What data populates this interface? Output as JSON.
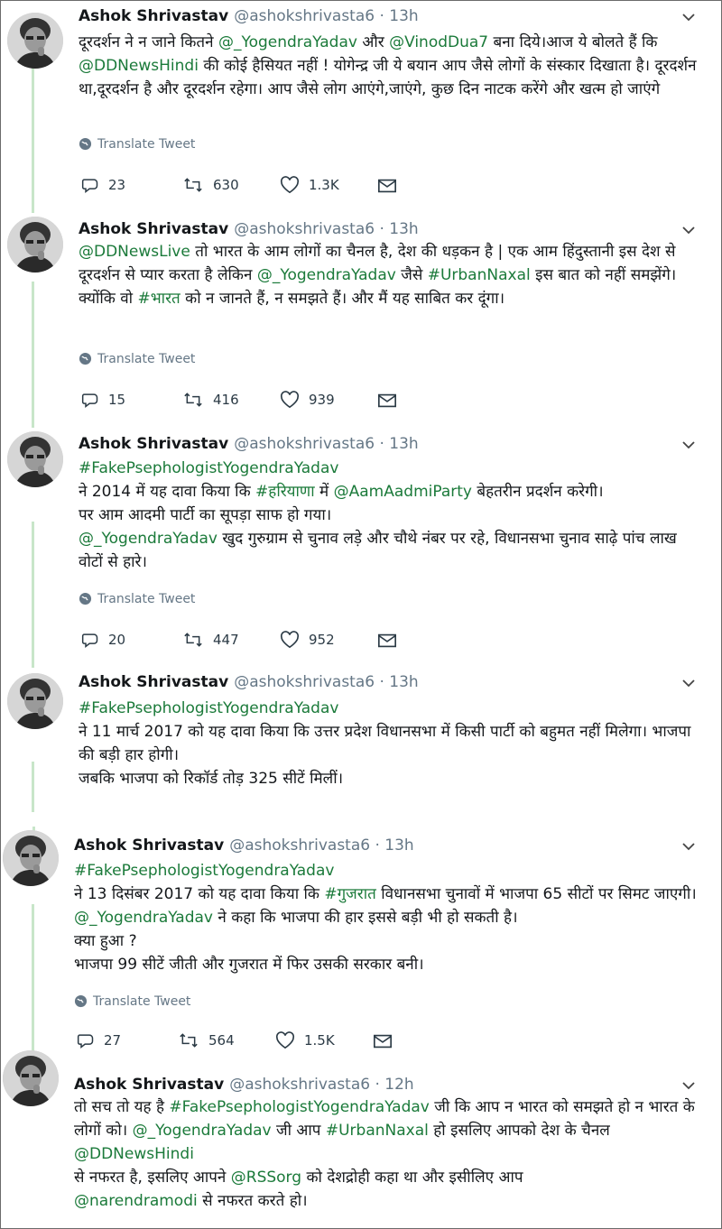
{
  "tweets": [
    {
      "name": "Ashok Shrivastav",
      "handle": "@ashokshrivasta6 · 13h",
      "body": [
        {
          "t": "दूरदर्शन ने न जाने कितने "
        },
        {
          "t": "@_YogendraYadav",
          "link": true
        },
        {
          "t": " और "
        },
        {
          "t": "@VinodDua7",
          "link": true
        },
        {
          "t": " बना दिये।आज ये बोलते हैं कि "
        },
        {
          "t": "@DDNewsHindi",
          "link": true
        },
        {
          "t": " की कोई हैसियत नहीं ! योगेन्द्र जी ये बयान आप जैसे लोगों के संस्कार दिखाता है। दूरदर्शन था,दूरदर्शन है और दूरदर्शन रहेगा। आप जैसे लोग आएंगे,जाएंगे, कुछ दिन नाटक करेंगे और खत्म हो जाएंगे"
        }
      ],
      "translate": "Translate Tweet",
      "replies": "23",
      "retweets": "630",
      "likes": "1.3K"
    },
    {
      "name": "Ashok Shrivastav",
      "handle": "@ashokshrivasta6 · 13h",
      "body": [
        {
          "t": "@DDNewsLive",
          "link": true
        },
        {
          "t": " तो भारत के आम लोगों का चैनल है, देश की धड़कन है | एक आम हिंदुस्तानी इस देश से दूरदर्शन से प्यार करता है लेकिन "
        },
        {
          "t": "@_YogendraYadav",
          "link": true
        },
        {
          "t": " जैसे "
        },
        {
          "t": "#UrbanNaxal",
          "link": true
        },
        {
          "t": " इस बात को नहीं समझेंगे। क्योंकि वो "
        },
        {
          "t": "#भारत",
          "link": true
        },
        {
          "t": " को न जानते हैं, न समझते हैं। और मैं यह साबित कर दूंगा।"
        }
      ],
      "translate": "Translate Tweet",
      "replies": "15",
      "retweets": "416",
      "likes": "939"
    },
    {
      "name": "Ashok Shrivastav",
      "handle": "@ashokshrivasta6 · 13h",
      "body": [
        {
          "t": "#FakePsephologistYogendraYadav",
          "link": true
        },
        {
          "t": "\nने 2014 में यह दावा किया कि "
        },
        {
          "t": "#हरियाणा",
          "link": true
        },
        {
          "t": " में "
        },
        {
          "t": "@AamAadmiParty",
          "link": true
        },
        {
          "t": " बेहतरीन प्रदर्शन करेगी।\nपर आम आदमी पार्टी का सूपड़ा साफ हो गया।\n"
        },
        {
          "t": "@_YogendraYadav",
          "link": true
        },
        {
          "t": " खुद गुरुग्राम से चुनाव लड़े और चौथे नंबर पर रहे, विधानसभा चुनाव साढ़े पांच लाख वोटों से हारे।"
        }
      ],
      "translate": "Translate Tweet",
      "replies": "20",
      "retweets": "447",
      "likes": "952"
    },
    {
      "name": "Ashok Shrivastav",
      "handle": "@ashokshrivasta6 · 13h",
      "body": [
        {
          "t": "#FakePsephologistYogendraYadav",
          "link": true
        },
        {
          "t": "\nने 11 मार्च 2017 को यह दावा किया कि उत्तर प्रदेश विधानसभा में किसी पार्टी को बहुमत नहीं मिलेगा। भाजपा की बड़ी हार होगी।\nजबकि भाजपा को रिकॉर्ड तोड़ 325 सीटें मिलीं।"
        }
      ]
    },
    {
      "name": "Ashok Shrivastav",
      "handle": "@ashokshrivasta6 · 13h",
      "body": [
        {
          "t": "#FakePsephologistYogendraYadav",
          "link": true
        },
        {
          "t": "\nने 13 दिसंबर 2017 को यह दावा किया कि "
        },
        {
          "t": "#गुजरात",
          "link": true
        },
        {
          "t": " विधानसभा चुनावों में भाजपा 65 सीटों पर सिमट जाएगी। "
        },
        {
          "t": "@_YogendraYadav",
          "link": true
        },
        {
          "t": " ने कहा कि भाजपा की हार इससे बड़ी भी हो सकती है।\nक्या हुआ ?\nभाजपा 99 सीटें जीती और गुजरात में फिर उसकी सरकार बनी।"
        }
      ],
      "translate": "Translate Tweet",
      "replies": "27",
      "retweets": "564",
      "likes": "1.5K"
    },
    {
      "name": "Ashok Shrivastav",
      "handle": "@ashokshrivasta6 · 12h",
      "body": [
        {
          "t": "तो सच तो यह है "
        },
        {
          "t": "#FakePsephologistYogendraYadav",
          "link": true
        },
        {
          "t": " जी कि आप न भारत को समझते हो न भारत के लोगों को। "
        },
        {
          "t": "@_YogendraYadav",
          "link": true
        },
        {
          "t": " जी आप "
        },
        {
          "t": "#UrbanNaxal",
          "link": true
        },
        {
          "t": " हो इसलिए आपको देश के चैनल "
        },
        {
          "t": "@DDNewsHindi",
          "link": true
        },
        {
          "t": "\nसे नफरत है, इसलिए आपने "
        },
        {
          "t": "@RSSorg",
          "link": true
        },
        {
          "t": " को देशद्रोही कहा था और इसीलिए आप\n"
        },
        {
          "t": "@narendramodi",
          "link": true
        },
        {
          "t": " से नफरत करते हो।"
        }
      ]
    }
  ],
  "icons": {
    "reply": "reply-icon",
    "retweet": "retweet-icon",
    "like": "heart-icon",
    "dm": "envelope-icon",
    "more": "chevron-down-icon",
    "translate": "globe-icon"
  },
  "colors": {
    "link": "#1b7a3a",
    "thread": "#c8e6c9",
    "muted": "#657786"
  }
}
